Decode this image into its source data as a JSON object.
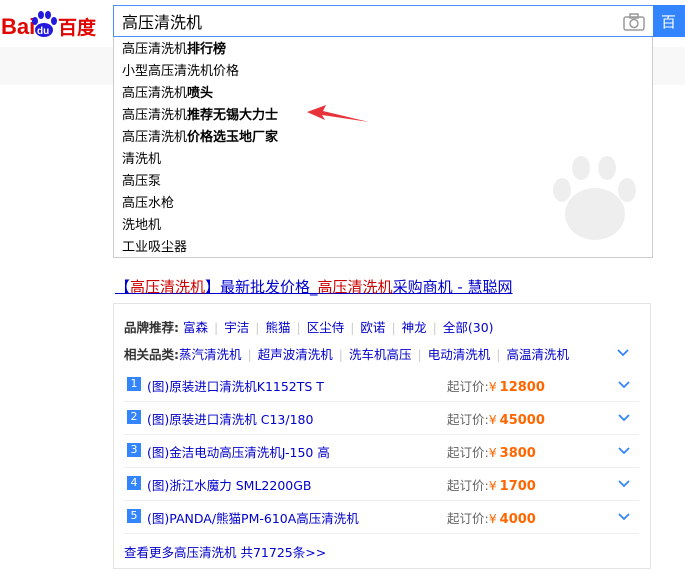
{
  "logo": {
    "text_left": "Bai",
    "text_du": "du",
    "text_right": "百度"
  },
  "search": {
    "value": "高压清洗机",
    "button_label": "百"
  },
  "suggestions": [
    {
      "prefix": "高压清洗机",
      "suffix": "排行榜"
    },
    {
      "prefix": "小型高压清洗机价格",
      "suffix": ""
    },
    {
      "prefix": "高压清洗机",
      "suffix": "喷头"
    },
    {
      "prefix": "高压清洗机",
      "suffix": "推荐无锡大力士"
    },
    {
      "prefix": "高压清洗机",
      "suffix": "价格选玉地厂家"
    },
    {
      "prefix": "清洗机",
      "suffix": ""
    },
    {
      "prefix": "高压泵",
      "suffix": ""
    },
    {
      "prefix": "高压水枪",
      "suffix": ""
    },
    {
      "prefix": "洗地机",
      "suffix": ""
    },
    {
      "prefix": "工业吸尘器",
      "suffix": ""
    }
  ],
  "result": {
    "title_open": "【",
    "title_hl1": "高压清洗机",
    "title_mid": "】最新批发价格_",
    "title_hl2": "高压清洗机",
    "title_tail": "采购商机 - 慧聪网"
  },
  "brands": {
    "label": "品牌推荐:",
    "items": [
      "富森",
      "宇洁",
      "熊猫",
      "区尘侍",
      "欧诺",
      "神龙",
      "全部(30)"
    ]
  },
  "related": {
    "label": "相关品类:",
    "items": [
      "蒸汽清洗机",
      "超声波清洗机",
      "洗车机高压",
      "电动清洗机",
      "高温清洗机"
    ]
  },
  "products": [
    {
      "num": "1",
      "name": "(图)原装进口清洗机K1152TS T",
      "price_label": "起订价:",
      "currency": "¥",
      "price": "12800"
    },
    {
      "num": "2",
      "name": "(图)原装进口清洗机 C13/180",
      "price_label": "起订价:",
      "currency": "¥",
      "price": "45000"
    },
    {
      "num": "3",
      "name": "(图)金洁电动高压清洗机J-150 高",
      "price_label": "起订价:",
      "currency": "¥",
      "price": "3800"
    },
    {
      "num": "4",
      "name": "(图)浙江水魔力 SML2200GB",
      "price_label": "起订价:",
      "currency": "¥",
      "price": "1700"
    },
    {
      "num": "5",
      "name": "(图)PANDA/熊猫PM-610A高压清洗机",
      "price_label": "起订价:",
      "currency": "¥",
      "price": "4000"
    }
  ],
  "more_link": "查看更多高压清洗机 共71725条>>",
  "colors": {
    "accent": "#3385ff",
    "link": "#0000cc",
    "highlight": "#cc0000",
    "price": "#ff6600",
    "arrow": "#e8323c"
  }
}
